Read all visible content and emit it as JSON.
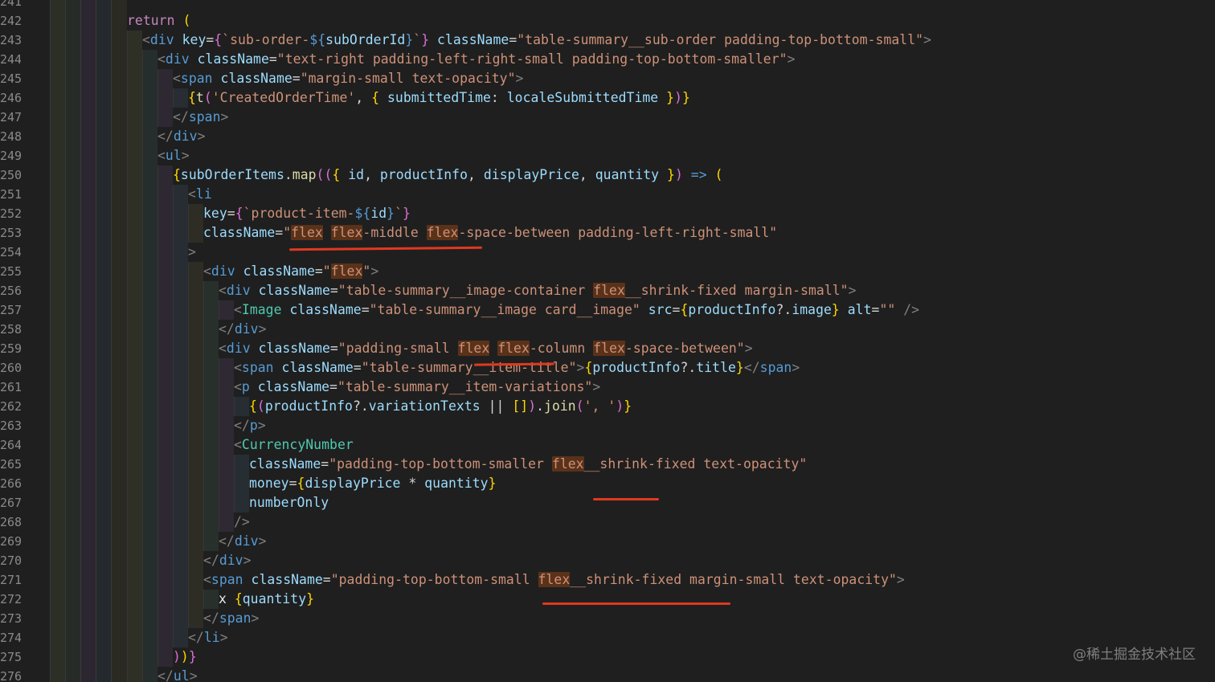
{
  "editor": {
    "lines": [
      {
        "num": "241",
        "indent": 0,
        "tokens": []
      },
      {
        "num": "242",
        "indent": 0,
        "tokens": [
          [
            "kw",
            "return"
          ],
          [
            "op",
            " "
          ],
          [
            "brace",
            "("
          ]
        ]
      },
      {
        "num": "243",
        "indent": 1,
        "tokens": [
          [
            "punc",
            "<"
          ],
          [
            "tag",
            "div"
          ],
          [
            "op",
            " "
          ],
          [
            "attr",
            "key"
          ],
          [
            "op",
            "="
          ],
          [
            "brace2",
            "{"
          ],
          [
            "str",
            "`sub-order-"
          ],
          [
            "tag",
            "${"
          ],
          [
            "var",
            "subOrderId"
          ],
          [
            "tag",
            "}"
          ],
          [
            "str",
            "`"
          ],
          [
            "brace2",
            "}"
          ],
          [
            "op",
            " "
          ],
          [
            "attr",
            "className"
          ],
          [
            "op",
            "="
          ],
          [
            "str",
            "\"table-summary__sub-order padding-top-bottom-small\""
          ],
          [
            "punc",
            ">"
          ]
        ]
      },
      {
        "num": "244",
        "indent": 2,
        "tokens": [
          [
            "punc",
            "<"
          ],
          [
            "tag",
            "div"
          ],
          [
            "op",
            " "
          ],
          [
            "attr",
            "className"
          ],
          [
            "op",
            "="
          ],
          [
            "str",
            "\"text-right padding-left-right-small padding-top-bottom-smaller\""
          ],
          [
            "punc",
            ">"
          ]
        ]
      },
      {
        "num": "245",
        "indent": 3,
        "tokens": [
          [
            "punc",
            "<"
          ],
          [
            "tag",
            "span"
          ],
          [
            "op",
            " "
          ],
          [
            "attr",
            "className"
          ],
          [
            "op",
            "="
          ],
          [
            "str",
            "\"margin-small text-opacity\""
          ],
          [
            "punc",
            ">"
          ]
        ]
      },
      {
        "num": "246",
        "indent": 4,
        "tokens": [
          [
            "brace",
            "{"
          ],
          [
            "fn",
            "t"
          ],
          [
            "brace2",
            "("
          ],
          [
            "str",
            "'CreatedOrderTime'"
          ],
          [
            "op",
            ", "
          ],
          [
            "brace",
            "{"
          ],
          [
            "op",
            " "
          ],
          [
            "var",
            "submittedTime"
          ],
          [
            "op",
            ": "
          ],
          [
            "var",
            "localeSubmittedTime"
          ],
          [
            "op",
            " "
          ],
          [
            "brace",
            "}"
          ],
          [
            "brace2",
            ")"
          ],
          [
            "brace",
            "}"
          ]
        ]
      },
      {
        "num": "247",
        "indent": 3,
        "tokens": [
          [
            "punc",
            "</"
          ],
          [
            "tag",
            "span"
          ],
          [
            "punc",
            ">"
          ]
        ]
      },
      {
        "num": "248",
        "indent": 2,
        "tokens": [
          [
            "punc",
            "</"
          ],
          [
            "tag",
            "div"
          ],
          [
            "punc",
            ">"
          ]
        ]
      },
      {
        "num": "249",
        "indent": 2,
        "tokens": [
          [
            "punc",
            "<"
          ],
          [
            "tag",
            "ul"
          ],
          [
            "punc",
            ">"
          ]
        ]
      },
      {
        "num": "250",
        "indent": 3,
        "tokens": [
          [
            "brace",
            "{"
          ],
          [
            "var",
            "subOrderItems"
          ],
          [
            "op",
            "."
          ],
          [
            "fn",
            "map"
          ],
          [
            "brace2",
            "(("
          ],
          [
            "brace",
            "{"
          ],
          [
            "op",
            " "
          ],
          [
            "var",
            "id"
          ],
          [
            "op",
            ", "
          ],
          [
            "var",
            "productInfo"
          ],
          [
            "op",
            ", "
          ],
          [
            "var",
            "displayPrice"
          ],
          [
            "op",
            ", "
          ],
          [
            "var",
            "quantity"
          ],
          [
            "op",
            " "
          ],
          [
            "brace",
            "}"
          ],
          [
            "brace2",
            ")"
          ],
          [
            "op",
            " "
          ],
          [
            "arrow",
            "=>"
          ],
          [
            "op",
            " "
          ],
          [
            "brace",
            "("
          ]
        ]
      },
      {
        "num": "251",
        "indent": 4,
        "tokens": [
          [
            "punc",
            "<"
          ],
          [
            "tag",
            "li"
          ]
        ]
      },
      {
        "num": "252",
        "indent": 5,
        "tokens": [
          [
            "attr",
            "key"
          ],
          [
            "op",
            "="
          ],
          [
            "brace2",
            "{"
          ],
          [
            "str",
            "`product-item-"
          ],
          [
            "tag",
            "${"
          ],
          [
            "var",
            "id"
          ],
          [
            "tag",
            "}"
          ],
          [
            "str",
            "`"
          ],
          [
            "brace2",
            "}"
          ]
        ]
      },
      {
        "num": "253",
        "indent": 5,
        "tokens": [
          [
            "attr",
            "className"
          ],
          [
            "op",
            "="
          ],
          [
            "str",
            "\""
          ],
          [
            "hl",
            "flex"
          ],
          [
            "str",
            " "
          ],
          [
            "hl",
            "flex"
          ],
          [
            "str",
            "-middle "
          ],
          [
            "hl",
            "flex"
          ],
          [
            "str",
            "-space-between padding-left-right-small\""
          ]
        ]
      },
      {
        "num": "254",
        "indent": 4,
        "tokens": [
          [
            "punc",
            ">"
          ]
        ]
      },
      {
        "num": "255",
        "indent": 5,
        "tokens": [
          [
            "punc",
            "<"
          ],
          [
            "tag",
            "div"
          ],
          [
            "op",
            " "
          ],
          [
            "attr",
            "className"
          ],
          [
            "op",
            "="
          ],
          [
            "str",
            "\""
          ],
          [
            "hl",
            "flex"
          ],
          [
            "str",
            "\""
          ],
          [
            "punc",
            ">"
          ]
        ]
      },
      {
        "num": "256",
        "indent": 6,
        "tokens": [
          [
            "punc",
            "<"
          ],
          [
            "tag",
            "div"
          ],
          [
            "op",
            " "
          ],
          [
            "attr",
            "className"
          ],
          [
            "op",
            "="
          ],
          [
            "str",
            "\"table-summary__image-container "
          ],
          [
            "hl",
            "flex"
          ],
          [
            "str",
            "__shrink-fixed margin-small\""
          ],
          [
            "punc",
            ">"
          ]
        ]
      },
      {
        "num": "257",
        "indent": 7,
        "tokens": [
          [
            "punc",
            "<"
          ],
          [
            "comp",
            "Image"
          ],
          [
            "op",
            " "
          ],
          [
            "attr",
            "className"
          ],
          [
            "op",
            "="
          ],
          [
            "str",
            "\"table-summary__image card__image\""
          ],
          [
            "op",
            " "
          ],
          [
            "attr",
            "src"
          ],
          [
            "op",
            "="
          ],
          [
            "brace",
            "{"
          ],
          [
            "var",
            "productInfo"
          ],
          [
            "op",
            "?."
          ],
          [
            "var",
            "image"
          ],
          [
            "brace",
            "}"
          ],
          [
            "op",
            " "
          ],
          [
            "attr",
            "alt"
          ],
          [
            "op",
            "="
          ],
          [
            "str",
            "\"\""
          ],
          [
            "op",
            " "
          ],
          [
            "punc",
            "/>"
          ]
        ]
      },
      {
        "num": "258",
        "indent": 6,
        "tokens": [
          [
            "punc",
            "</"
          ],
          [
            "tag",
            "div"
          ],
          [
            "punc",
            ">"
          ]
        ]
      },
      {
        "num": "259",
        "indent": 6,
        "tokens": [
          [
            "punc",
            "<"
          ],
          [
            "tag",
            "div"
          ],
          [
            "op",
            " "
          ],
          [
            "attr",
            "className"
          ],
          [
            "op",
            "="
          ],
          [
            "str",
            "\"padding-small "
          ],
          [
            "hl",
            "flex"
          ],
          [
            "str",
            " "
          ],
          [
            "hl",
            "flex"
          ],
          [
            "str",
            "-column "
          ],
          [
            "hl",
            "flex"
          ],
          [
            "str",
            "-space-between\""
          ],
          [
            "punc",
            ">"
          ]
        ]
      },
      {
        "num": "260",
        "indent": 7,
        "tokens": [
          [
            "punc",
            "<"
          ],
          [
            "tag",
            "span"
          ],
          [
            "op",
            " "
          ],
          [
            "attr",
            "className"
          ],
          [
            "op",
            "="
          ],
          [
            "str",
            "\"table-summary__item-title\""
          ],
          [
            "punc",
            ">"
          ],
          [
            "brace",
            "{"
          ],
          [
            "var",
            "productInfo"
          ],
          [
            "op",
            "?."
          ],
          [
            "var",
            "title"
          ],
          [
            "brace",
            "}"
          ],
          [
            "punc",
            "</"
          ],
          [
            "tag",
            "span"
          ],
          [
            "punc",
            ">"
          ]
        ]
      },
      {
        "num": "261",
        "indent": 7,
        "tokens": [
          [
            "punc",
            "<"
          ],
          [
            "tag",
            "p"
          ],
          [
            "op",
            " "
          ],
          [
            "attr",
            "className"
          ],
          [
            "op",
            "="
          ],
          [
            "str",
            "\"table-summary__item-variations\""
          ],
          [
            "punc",
            ">"
          ]
        ]
      },
      {
        "num": "262",
        "indent": 8,
        "tokens": [
          [
            "brace",
            "{"
          ],
          [
            "brace2",
            "("
          ],
          [
            "var",
            "productInfo"
          ],
          [
            "op",
            "?."
          ],
          [
            "var",
            "variationTexts"
          ],
          [
            "op",
            " || "
          ],
          [
            "brace",
            "[]"
          ],
          [
            "brace2",
            ")"
          ],
          [
            "op",
            "."
          ],
          [
            "fn",
            "join"
          ],
          [
            "brace2",
            "("
          ],
          [
            "str",
            "', '"
          ],
          [
            "brace2",
            ")"
          ],
          [
            "brace",
            "}"
          ]
        ]
      },
      {
        "num": "263",
        "indent": 7,
        "tokens": [
          [
            "punc",
            "</"
          ],
          [
            "tag",
            "p"
          ],
          [
            "punc",
            ">"
          ]
        ]
      },
      {
        "num": "264",
        "indent": 7,
        "tokens": [
          [
            "punc",
            "<"
          ],
          [
            "comp",
            "CurrencyNumber"
          ]
        ]
      },
      {
        "num": "265",
        "indent": 8,
        "tokens": [
          [
            "attr",
            "className"
          ],
          [
            "op",
            "="
          ],
          [
            "str",
            "\"padding-top-bottom-smaller "
          ],
          [
            "hl",
            "flex"
          ],
          [
            "str",
            "__shrink-fixed text-opacity\""
          ]
        ]
      },
      {
        "num": "266",
        "indent": 8,
        "tokens": [
          [
            "attr",
            "money"
          ],
          [
            "op",
            "="
          ],
          [
            "brace",
            "{"
          ],
          [
            "var",
            "displayPrice"
          ],
          [
            "op",
            " * "
          ],
          [
            "var",
            "quantity"
          ],
          [
            "brace",
            "}"
          ]
        ]
      },
      {
        "num": "267",
        "indent": 8,
        "tokens": [
          [
            "attr",
            "numberOnly"
          ]
        ]
      },
      {
        "num": "268",
        "indent": 7,
        "tokens": [
          [
            "punc",
            "/>"
          ]
        ]
      },
      {
        "num": "269",
        "indent": 6,
        "tokens": [
          [
            "punc",
            "</"
          ],
          [
            "tag",
            "div"
          ],
          [
            "punc",
            ">"
          ]
        ]
      },
      {
        "num": "270",
        "indent": 5,
        "tokens": [
          [
            "punc",
            "</"
          ],
          [
            "tag",
            "div"
          ],
          [
            "punc",
            ">"
          ]
        ]
      },
      {
        "num": "271",
        "indent": 5,
        "tokens": [
          [
            "punc",
            "<"
          ],
          [
            "tag",
            "span"
          ],
          [
            "op",
            " "
          ],
          [
            "attr",
            "className"
          ],
          [
            "op",
            "="
          ],
          [
            "str",
            "\"padding-top-bottom-small "
          ],
          [
            "hl",
            "flex"
          ],
          [
            "str",
            "__shrink-fixed margin-small text-opacity\""
          ],
          [
            "punc",
            ">"
          ]
        ]
      },
      {
        "num": "272",
        "indent": 6,
        "tokens": [
          [
            "plain",
            "x "
          ],
          [
            "brace",
            "{"
          ],
          [
            "var",
            "quantity"
          ],
          [
            "brace",
            "}"
          ]
        ]
      },
      {
        "num": "273",
        "indent": 5,
        "tokens": [
          [
            "punc",
            "</"
          ],
          [
            "tag",
            "span"
          ],
          [
            "punc",
            ">"
          ]
        ]
      },
      {
        "num": "274",
        "indent": 4,
        "tokens": [
          [
            "punc",
            "</"
          ],
          [
            "tag",
            "li"
          ],
          [
            "punc",
            ">"
          ]
        ]
      },
      {
        "num": "275",
        "indent": 3,
        "tokens": [
          [
            "brace2",
            ")"
          ],
          [
            "brace",
            ")"
          ],
          [
            "brace2",
            "}"
          ]
        ]
      },
      {
        "num": "276",
        "indent": 2,
        "tokens": [
          [
            "punc",
            "</"
          ],
          [
            "tag",
            "ul"
          ],
          [
            "punc",
            ">"
          ]
        ]
      }
    ]
  },
  "colors": {
    "background": "#1f1f1f",
    "highlight": "#5a3219",
    "annotation_red": "#e0391f"
  },
  "watermark": "@稀土掘金技术社区"
}
